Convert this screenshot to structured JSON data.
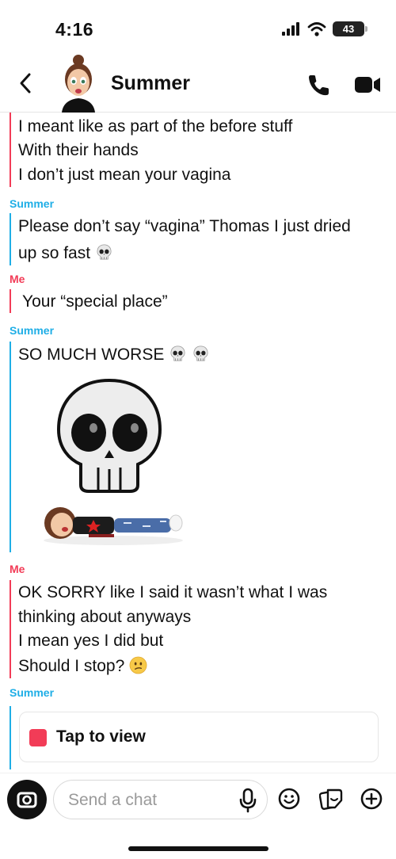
{
  "status_bar": {
    "time": "4:16",
    "battery": "43"
  },
  "header": {
    "name": "Summer"
  },
  "messages": {
    "m1": {
      "lines": [
        "I meant like as part of the before stuff",
        "With their hands",
        "I don’t just mean your vagina"
      ]
    },
    "s1": {
      "sender": "Summer",
      "line1": "Please don’t say “vagina” Thomas I just dried",
      "line2": "up so fast"
    },
    "s2": {
      "sender": "Me",
      "line1": "Your “special place”"
    },
    "s3": {
      "sender": "Summer",
      "line1": "SO MUCH WORSE"
    },
    "s4": {
      "sender": "Me",
      "lines": [
        "OK SORRY like I said it wasn’t what I was",
        "thinking about anyways",
        "I mean yes I did but",
        "Should I stop?"
      ]
    },
    "s5": {
      "sender": "Summer",
      "tap_label": "Tap to view"
    }
  },
  "composer": {
    "placeholder": "Send a chat"
  },
  "icons": [
    "back-icon",
    "phone-icon",
    "video-icon",
    "skull-emoji",
    "camera-icon",
    "mic-icon",
    "smiley-icon",
    "sticker-icon",
    "plus-icon"
  ],
  "colors": {
    "me": "#f23c57",
    "them": "#1faee6"
  }
}
